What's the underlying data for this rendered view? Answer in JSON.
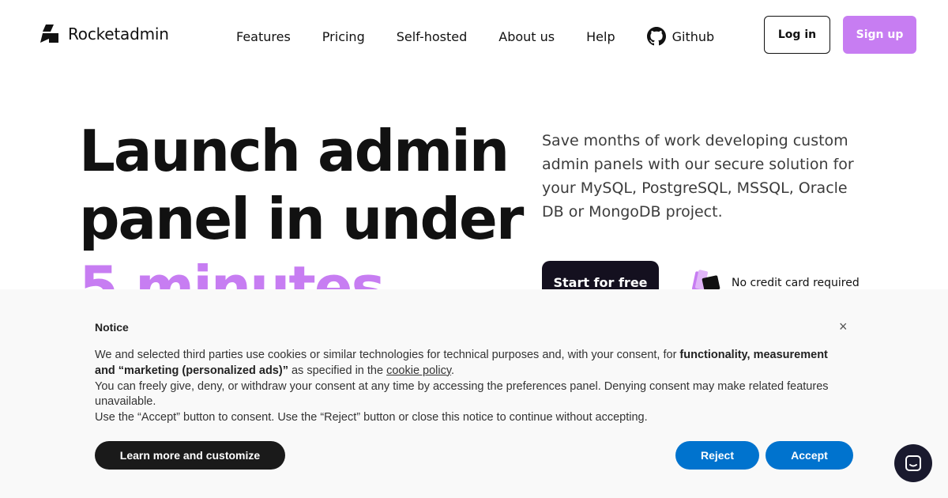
{
  "header": {
    "logo_text": "Rocketadmin",
    "nav": [
      "Features",
      "Pricing",
      "Self-hosted",
      "About us",
      "Help"
    ],
    "github_label": "Github",
    "login_label": "Log in",
    "signup_label": "Sign up"
  },
  "hero": {
    "title_line1": "Launch admin",
    "title_line2": "panel in under",
    "title_line3": "5 minutes",
    "description": "Save months of work developing custom admin panels with our secure solution for your MySQL, PostgreSQL, MSSQL, Oracle DB or MongoDB project.",
    "cta_label": "Start for free",
    "no_card_text": "No credit card required"
  },
  "cookie_notice": {
    "title": "Notice",
    "close_glyph": "×",
    "p1_a": "We and selected third parties use cookies or similar technologies for technical purposes and, with your consent, for ",
    "p1_bold": "functionality, measurement and “marketing (personalized ads)”",
    "p1_b": " as specified in the ",
    "p1_link": "cookie policy",
    "p1_c": ".",
    "p2": "You can freely give, deny, or withdraw your consent at any time by accessing the preferences panel. Denying consent may make related features unavailable.",
    "p3": "Use the “Accept” button to consent. Use the “Reject” button or close this notice to continue without accepting.",
    "learn_more_label": "Learn more and customize",
    "reject_label": "Reject",
    "accept_label": "Accept"
  },
  "colors": {
    "accent": "#c77df2",
    "cta_dark": "#14101f",
    "consent_blue": "#0073ce"
  },
  "icons": {
    "logo": "rocketadmin-logo-icon",
    "github": "github-icon",
    "card": "credit-card-icon",
    "chat": "chat-icon"
  }
}
